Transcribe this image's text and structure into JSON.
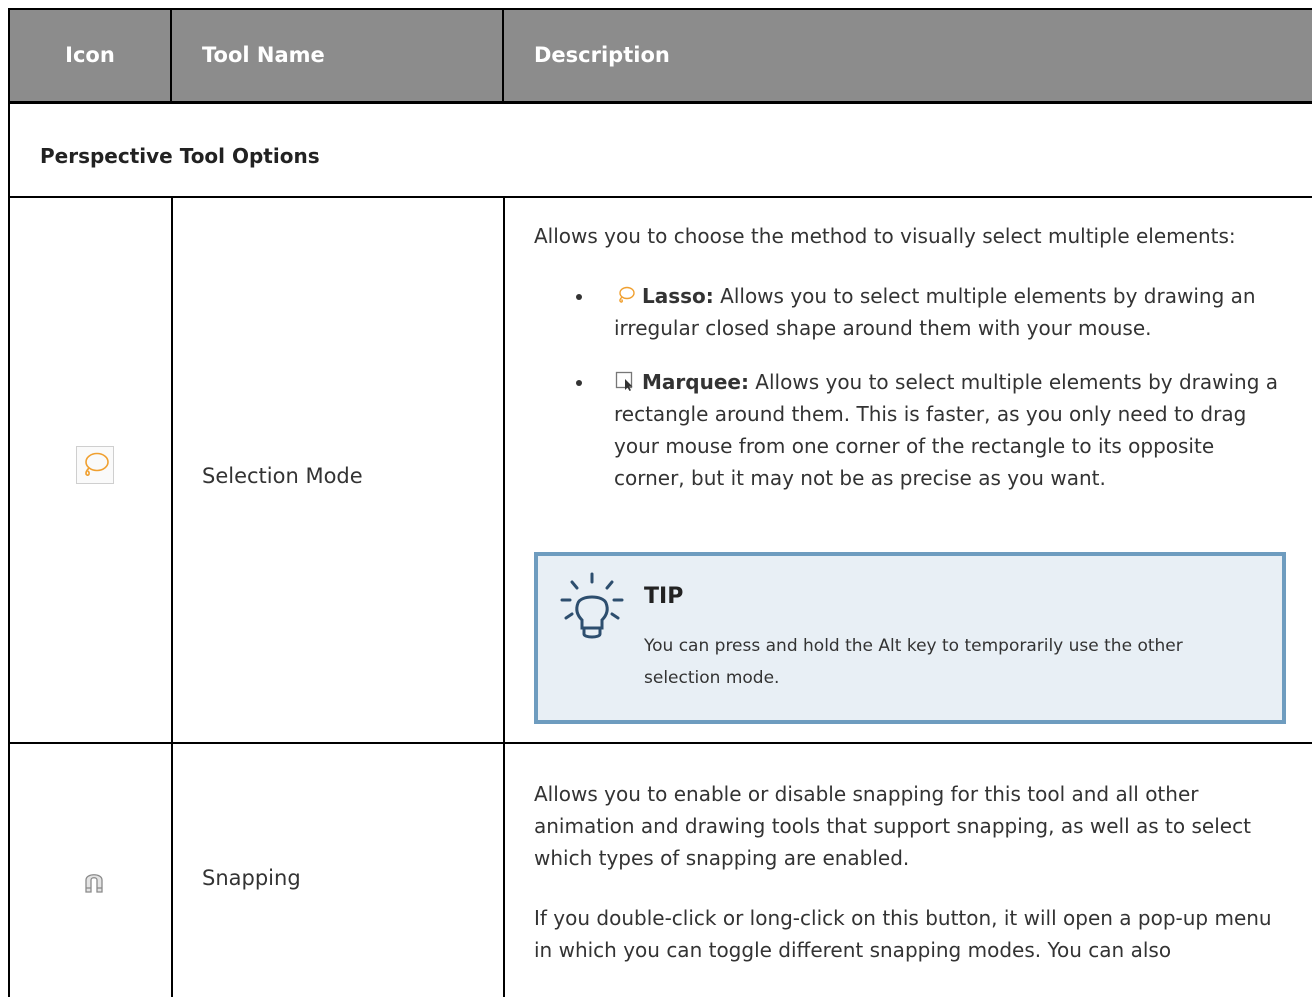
{
  "header": {
    "icon": "Icon",
    "tool_name": "Tool Name",
    "description": "Description"
  },
  "section": {
    "title": "Perspective Tool Options"
  },
  "rows": [
    {
      "icon": "lasso-icon",
      "name": "Selection Mode",
      "intro": "Allows you to choose the method to visually select multiple elements:",
      "bullets": [
        {
          "icon": "lasso-icon",
          "label": "Lasso:",
          "text": " Allows you to select multiple elements by drawing an irregular closed shape around them with your mouse."
        },
        {
          "icon": "marquee-icon",
          "label": "Marquee:",
          "text": " Allows you to select multiple elements by drawing a rectangle around them. This is faster, as you only need to drag your mouse from one corner of the rectangle to its opposite corner, but it may not be as precise as you want."
        }
      ],
      "tip": {
        "icon": "lightbulb-icon",
        "title": "TIP",
        "text": "You can press and hold the Alt key to temporarily use the other selection mode."
      }
    },
    {
      "icon": "magnet-icon",
      "name": "Snapping",
      "paragraphs": [
        "Allows you to enable or disable snapping for this tool and all other animation and drawing tools that support snapping, as well as to select which types of snapping are enabled.",
        "If you double-click or long-click on this button, it will open a pop-up menu in which you can toggle different snapping modes. You can also"
      ]
    }
  ],
  "colors": {
    "header_bg": "#8c8c8c",
    "tip_border": "#6e9cbf",
    "tip_bg": "#e8eff5",
    "lasso": "#f0a030"
  }
}
